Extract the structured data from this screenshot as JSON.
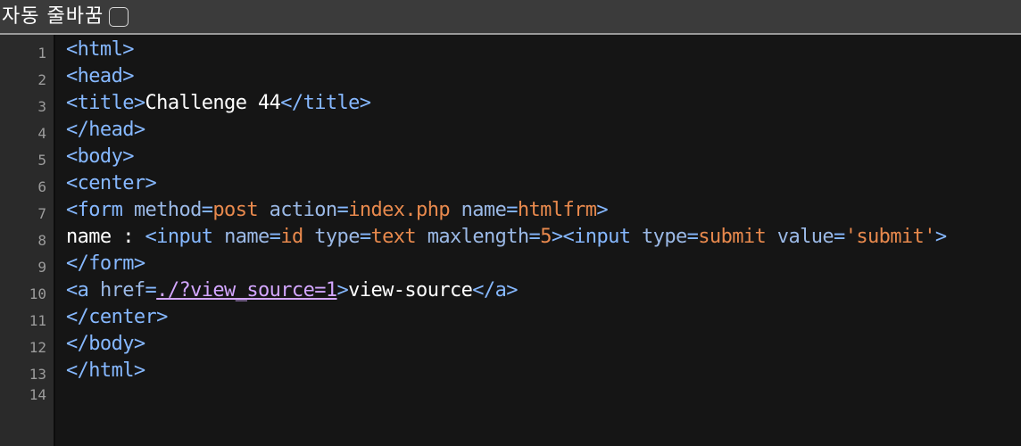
{
  "toolbar": {
    "wrap_label": "자동 줄바꿈",
    "wrap_checked": false
  },
  "gutter": {
    "line_numbers": [
      "1",
      "2",
      "3",
      "4",
      "5",
      "6",
      "7",
      "8",
      "9",
      "10",
      "11",
      "12",
      "13",
      "14"
    ]
  },
  "code": {
    "lines": [
      [
        {
          "t": "<html>",
          "c": "tag"
        }
      ],
      [
        {
          "t": "<head>",
          "c": "tag"
        }
      ],
      [
        {
          "t": "<title>",
          "c": "tag"
        },
        {
          "t": "Challenge 44",
          "c": "txt"
        },
        {
          "t": "</title>",
          "c": "tag"
        }
      ],
      [
        {
          "t": "</head>",
          "c": "tag"
        }
      ],
      [
        {
          "t": "<body>",
          "c": "tag"
        }
      ],
      [
        {
          "t": "<center>",
          "c": "tag"
        }
      ],
      [
        {
          "t": "<form ",
          "c": "tag"
        },
        {
          "t": "method",
          "c": "attr"
        },
        {
          "t": "=",
          "c": "tag"
        },
        {
          "t": "post",
          "c": "val"
        },
        {
          "t": " action",
          "c": "attr"
        },
        {
          "t": "=",
          "c": "tag"
        },
        {
          "t": "index.php",
          "c": "val"
        },
        {
          "t": " name",
          "c": "attr"
        },
        {
          "t": "=",
          "c": "tag"
        },
        {
          "t": "htmlfrm",
          "c": "val"
        },
        {
          "t": ">",
          "c": "tag"
        }
      ],
      [
        {
          "t": "name : ",
          "c": "txt"
        },
        {
          "t": "<input ",
          "c": "tag"
        },
        {
          "t": "name",
          "c": "attr"
        },
        {
          "t": "=",
          "c": "tag"
        },
        {
          "t": "id",
          "c": "val"
        },
        {
          "t": " type",
          "c": "attr"
        },
        {
          "t": "=",
          "c": "tag"
        },
        {
          "t": "text",
          "c": "val"
        },
        {
          "t": " maxlength",
          "c": "attr"
        },
        {
          "t": "=",
          "c": "tag"
        },
        {
          "t": "5",
          "c": "val"
        },
        {
          "t": "><input ",
          "c": "tag"
        },
        {
          "t": "type",
          "c": "attr"
        },
        {
          "t": "=",
          "c": "tag"
        },
        {
          "t": "submit",
          "c": "val"
        },
        {
          "t": " value",
          "c": "attr"
        },
        {
          "t": "=",
          "c": "tag"
        },
        {
          "t": "'submit'",
          "c": "str"
        },
        {
          "t": ">",
          "c": "tag"
        }
      ],
      [
        {
          "t": "</form>",
          "c": "tag"
        }
      ],
      [
        {
          "t": "<a ",
          "c": "tag"
        },
        {
          "t": "href",
          "c": "attr"
        },
        {
          "t": "=",
          "c": "tag"
        },
        {
          "t": "./?view_source=1",
          "c": "link"
        },
        {
          "t": ">",
          "c": "tag"
        },
        {
          "t": "view-source",
          "c": "txt"
        },
        {
          "t": "</a>",
          "c": "tag"
        }
      ],
      [
        {
          "t": "</center>",
          "c": "tag"
        }
      ],
      [
        {
          "t": "</body>",
          "c": "tag"
        }
      ],
      [
        {
          "t": "</html>",
          "c": "tag"
        }
      ],
      []
    ]
  },
  "colors": {
    "toolbar_bg": "#3b3b3b",
    "gutter_bg": "#2a2a2a",
    "editor_bg": "#151515",
    "tag": "#86b8ff",
    "attribute": "#9bb9e6",
    "value": "#e8894d",
    "text": "#ffffff",
    "link": "#d3a6ff"
  }
}
